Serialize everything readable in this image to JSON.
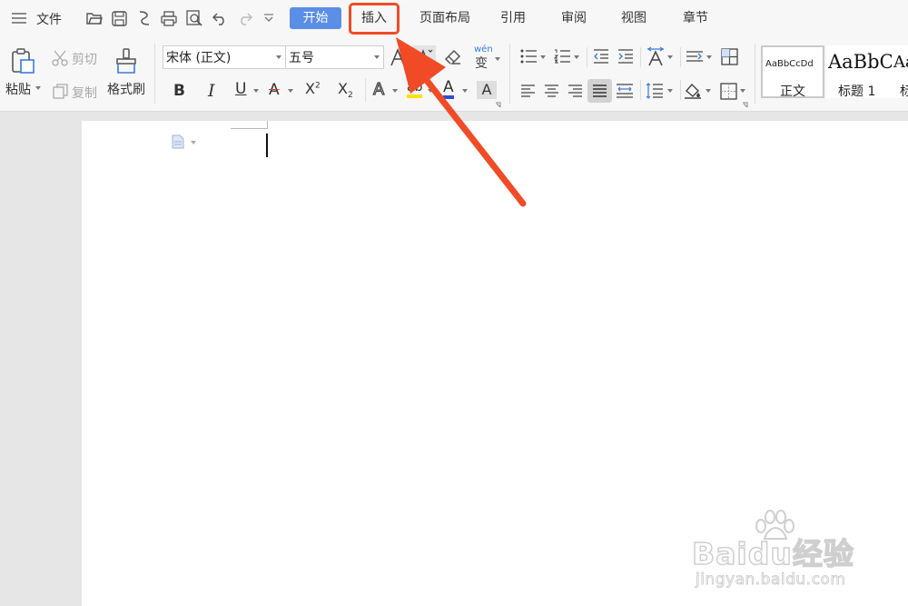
{
  "menubar": {
    "file_label": "文件",
    "tabs": [
      {
        "label": "开始"
      },
      {
        "label": "插入"
      },
      {
        "label": "页面布局"
      },
      {
        "label": "引用"
      },
      {
        "label": "审阅"
      },
      {
        "label": "视图"
      },
      {
        "label": "章节"
      }
    ]
  },
  "clipboard": {
    "paste": "粘贴",
    "cut": "剪切",
    "copy": "复制",
    "format_painter": "格式刷"
  },
  "font": {
    "name": "宋体 (正文)",
    "size": "五号",
    "phonetic_glyph": "wén",
    "phonetic_char": "变"
  },
  "format": {
    "bold": "B",
    "italic": "I",
    "underline": "U",
    "strike": "A",
    "superscript": "X",
    "superscript_mark": "2",
    "subscript": "X",
    "subscript_mark": "2",
    "text_effect": "A",
    "highlight": "ab",
    "font_color": "A",
    "char_shading": "A"
  },
  "styles": [
    {
      "preview": "AaBbCcDd",
      "name": "正文"
    },
    {
      "preview": "AaBbC",
      "name": "标题 1"
    },
    {
      "preview": "Aa",
      "name": "标"
    }
  ],
  "colors": {
    "accent": "#5b8ee6",
    "highlight_frame": "#f04b26",
    "arrow": "#f04b26",
    "highlight_yellow": "#ffe100",
    "font_color_blue": "#2a52d8"
  },
  "watermark": {
    "brand": "Baidu经验",
    "url": "jingyan.baidu.com"
  }
}
